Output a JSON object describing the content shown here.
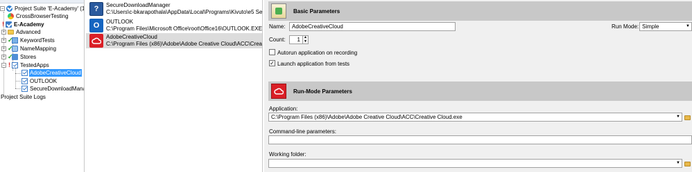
{
  "tree": {
    "items": [
      {
        "label": "Project Suite 'E-Academy' (1 project)"
      },
      {
        "label": "CrossBrowserTesting"
      },
      {
        "label": "E-Academy"
      },
      {
        "label": "Advanced"
      },
      {
        "label": "KeywordTests"
      },
      {
        "label": "NameMapping"
      },
      {
        "label": "Stores"
      },
      {
        "label": "TestedApps"
      },
      {
        "label": "AdobeCreativeCloud"
      },
      {
        "label": "OUTLOOK"
      },
      {
        "label": "SecureDownloadManager"
      },
      {
        "label": "Project Suite Logs"
      }
    ]
  },
  "apps_list": {
    "items": [
      {
        "name": "SecureDownloadManager",
        "path": "C:\\Users\\c-bkarapothala\\AppData\\Local\\Programs\\Kivuto\\e5 Secure Down"
      },
      {
        "name": "OUTLOOK",
        "path": "C:\\Program Files\\Microsoft Office\\root\\Office16\\OUTLOOK.EXE"
      },
      {
        "name": "AdobeCreativeCloud",
        "path": "C:\\Program Files (x86)\\Adobe\\Adobe Creative Cloud\\ACC\\Creative Cloud.exe"
      }
    ]
  },
  "basic": {
    "title": "Basic Parameters",
    "name_label": "Name:",
    "name_value": "AdobeCreativeCloud",
    "count_label": "Count:",
    "count_value": "1",
    "run_mode_label": "Run Mode:",
    "run_mode_value": "Simple",
    "autorun_label": "Autorun application on recording",
    "autorun_checked": false,
    "launch_label": "Launch application from tests",
    "launch_checked": true
  },
  "runmode": {
    "title": "Run-Mode Parameters",
    "application_label": "Application:",
    "application_value": "C:\\Program Files (x86)\\Adobe\\Adobe Creative Cloud\\ACC\\Creative Cloud.exe",
    "cmdline_label": "Command-line parameters:",
    "cmdline_value": "",
    "workdir_label": "Working folder:",
    "workdir_value": ""
  },
  "colors": {
    "selection": "#3399ff",
    "header_bg": "#c8c8c8",
    "adobe_red": "#da1f26",
    "outlook_blue": "#1565c0"
  },
  "icons": {
    "suite": "project-suite-icon",
    "cbt": "cross-browser-icon",
    "project": "project-icon",
    "folder": "folder-icon",
    "keyword": "keyword-tests-icon",
    "namemap": "name-mapping-icon",
    "stores": "stores-icon",
    "testedapps": "tested-apps-icon",
    "app": "tested-app-icon"
  }
}
